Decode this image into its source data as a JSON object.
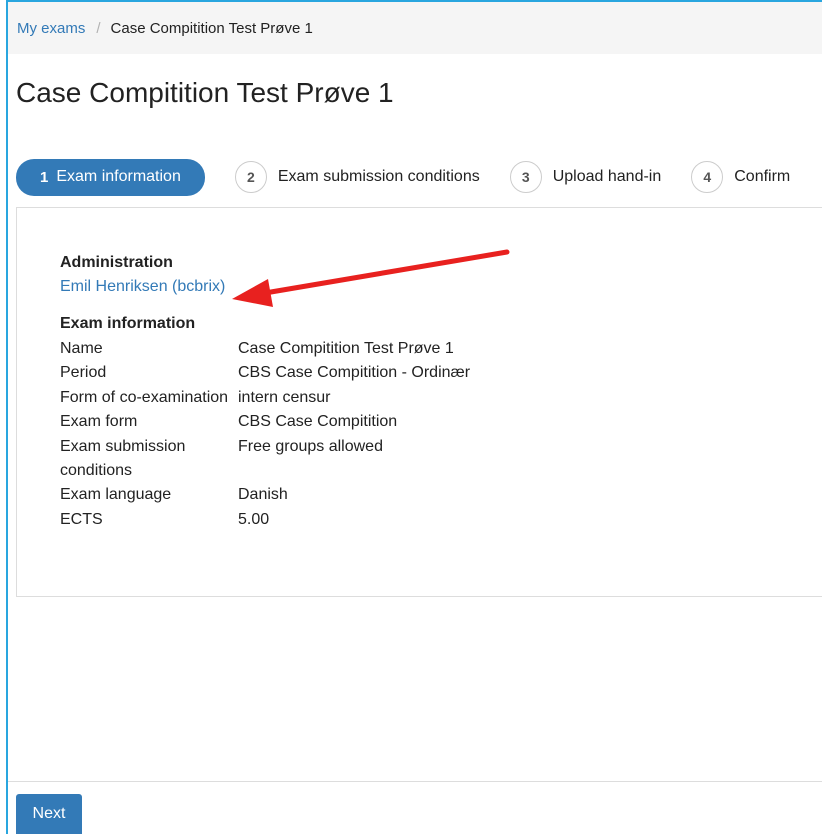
{
  "breadcrumb": {
    "home": "My exams",
    "separator": "/",
    "current": "Case Compitition Test Prøve 1"
  },
  "page_title": "Case Compitition Test Prøve 1",
  "steps": [
    {
      "number": "1",
      "label": "Exam information",
      "active": true
    },
    {
      "number": "2",
      "label": "Exam submission conditions",
      "active": false
    },
    {
      "number": "3",
      "label": "Upload hand-in",
      "active": false
    },
    {
      "number": "4",
      "label": "Confirm",
      "active": false
    }
  ],
  "administration": {
    "heading": "Administration",
    "contact": "Emil Henriksen (bcbrix)"
  },
  "exam_information": {
    "heading": "Exam information",
    "rows": [
      {
        "label": "Name",
        "value": "Case Compitition Test Prøve 1"
      },
      {
        "label": "Period",
        "value": "CBS Case Compitition - Ordinær"
      },
      {
        "label": "Form of co-examination",
        "value": "intern censur"
      },
      {
        "label": "Exam form",
        "value": "CBS Case Compitition"
      },
      {
        "label": "Exam submission conditions",
        "value": "Free groups allowed"
      },
      {
        "label": "Exam language",
        "value": "Danish"
      },
      {
        "label": "ECTS",
        "value": "5.00"
      }
    ]
  },
  "footer": {
    "next_label": "Next"
  },
  "colors": {
    "primary": "#337ab7",
    "annotation_arrow": "#e8211f",
    "frame_border": "#29a6df"
  }
}
